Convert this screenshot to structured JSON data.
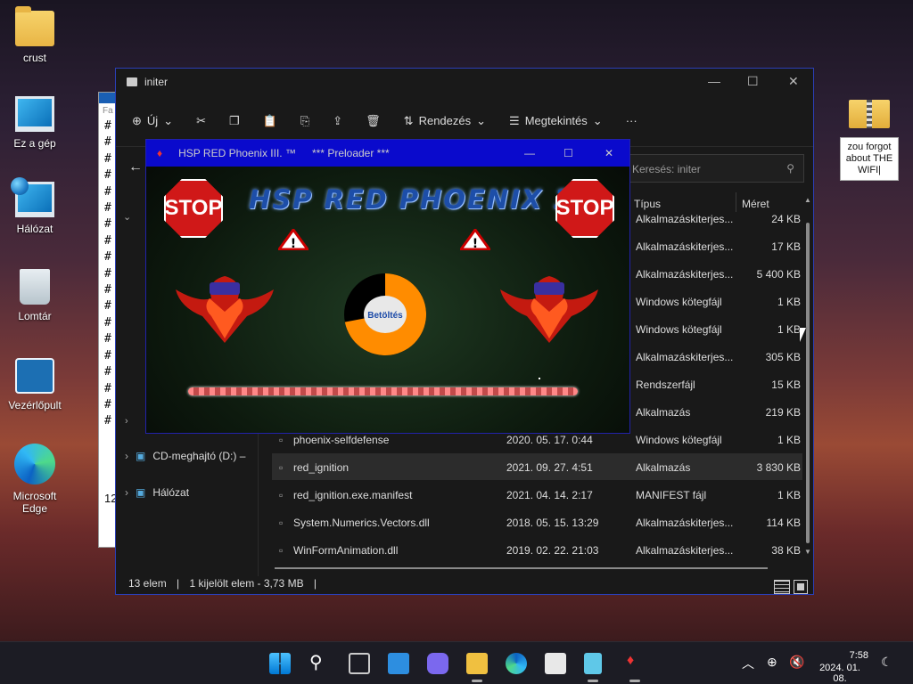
{
  "desktop": {
    "icons": [
      {
        "label": "crust",
        "icon": "folder-icon"
      },
      {
        "label": "Ez a gép",
        "icon": "this-pc-icon"
      },
      {
        "label": "Hálózat",
        "icon": "network-icon"
      },
      {
        "label": "Lomtár",
        "icon": "recycle-bin-icon"
      },
      {
        "label": "Vezérlőpult",
        "icon": "control-panel-icon"
      },
      {
        "label": "Microsoft Edge",
        "icon": "edge-icon"
      }
    ],
    "zip_icon": "zip-folder-icon",
    "sticky_note": "zou forgot about THE WIFI|"
  },
  "explorer": {
    "title": "initer",
    "toolbar": {
      "new": "Új",
      "sort": "Rendezés",
      "view": "Megtekintés",
      "more": "···"
    },
    "search_placeholder": "Keresés: initer",
    "columns": {
      "type": "Típus",
      "size": "Méret"
    },
    "nav": {
      "cd": "CD-meghajtó (D:) –",
      "network": "Hálózat"
    },
    "rows": [
      {
        "name": "",
        "date": "",
        "type": "Alkalmazáskiterjes...",
        "size": "24 KB"
      },
      {
        "name": "",
        "date": "",
        "type": "Alkalmazáskiterjes...",
        "size": "17 KB"
      },
      {
        "name": "",
        "date": "",
        "type": "Alkalmazáskiterjes...",
        "size": "5 400 KB"
      },
      {
        "name": "",
        "date": "",
        "type": "Windows kötegfájl",
        "size": "1 KB"
      },
      {
        "name": "",
        "date": "",
        "type": "Windows kötegfájl",
        "size": "1 KB"
      },
      {
        "name": "",
        "date": "",
        "type": "Alkalmazáskiterjes...",
        "size": "305 KB"
      },
      {
        "name": "",
        "date": "",
        "type": "Rendszerfájl",
        "size": "15 KB"
      },
      {
        "name": "",
        "date": "",
        "type": "Alkalmazás",
        "size": "219 KB"
      },
      {
        "name": "phoenix-selfdefense",
        "date": "2020. 05. 17. 0:44",
        "type": "Windows kötegfájl",
        "size": "1 KB"
      },
      {
        "name": "red_ignition",
        "date": "2021. 09. 27. 4:51",
        "type": "Alkalmazás",
        "size": "3 830 KB"
      },
      {
        "name": "red_ignition.exe.manifest",
        "date": "2021. 04. 14. 2:17",
        "type": "MANIFEST fájl",
        "size": "1 KB"
      },
      {
        "name": "System.Numerics.Vectors.dll",
        "date": "2018. 05. 15. 13:29",
        "type": "Alkalmazáskiterjes...",
        "size": "114 KB"
      },
      {
        "name": "WinFormAnimation.dll",
        "date": "2019. 02. 22. 21:03",
        "type": "Alkalmazáskiterjes...",
        "size": "38 KB"
      }
    ],
    "status": {
      "count": "13 elem",
      "selected": "1 kijelölt elem - 3,73 MB"
    }
  },
  "background_window": {
    "title_fragment": "Fa",
    "number": "12"
  },
  "preloader": {
    "title": "HSP RED Phoenix III. ™",
    "subtitle": "*** Preloader ***",
    "banner": "HSP RED PHOENIX 3",
    "stop_label": "STOP",
    "loading_label": "Betöltés",
    "progress": 0.72
  },
  "taskbar": {
    "time": "7:58",
    "date": "2024. 01. 08."
  }
}
